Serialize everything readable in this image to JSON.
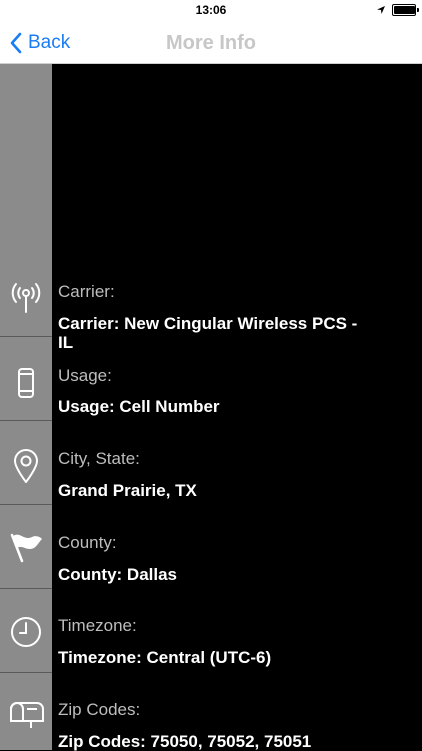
{
  "status": {
    "time": "13:06",
    "battery_level": 0.95
  },
  "nav": {
    "back_label": "Back",
    "title": "More Info"
  },
  "rows": [
    {
      "label": "Carrier:",
      "value": "Carrier: New Cingular Wireless PCS - IL",
      "icon": "antenna-icon"
    },
    {
      "label": "Usage:",
      "value": "Usage: Cell Number",
      "icon": "phone-icon"
    },
    {
      "label": "City, State:",
      "value": "Grand Prairie, TX",
      "icon": "location-pin-icon"
    },
    {
      "label": "County:",
      "value": "County: Dallas",
      "icon": "flag-icon"
    },
    {
      "label": "Timezone:",
      "value": "Timezone: Central (UTC-6)",
      "icon": "clock-icon"
    },
    {
      "label": "Zip Codes:",
      "value": "Zip Codes: 75050, 75052, 75051",
      "icon": "mailbox-icon"
    }
  ]
}
